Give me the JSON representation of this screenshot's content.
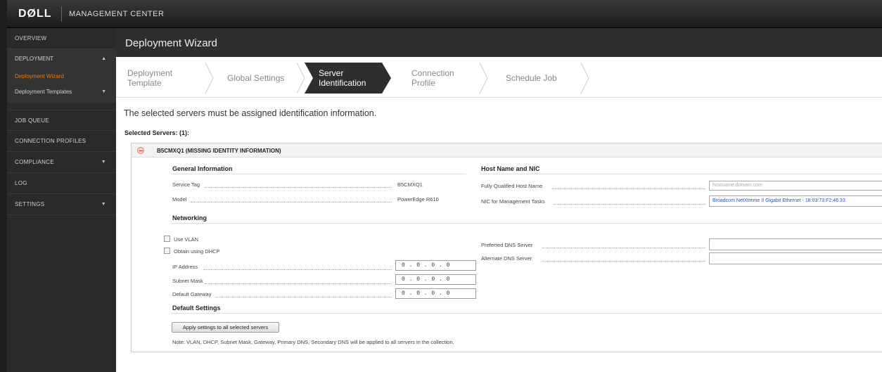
{
  "app": {
    "logo": "DØLL",
    "title": "MANAGEMENT CENTER"
  },
  "sidebar": {
    "overview": "OVERVIEW",
    "deployment": "DEPLOYMENT",
    "deployment_wizard": "Deployment Wizard",
    "deployment_templates": "Deployment Templates",
    "job_queue": "JOB QUEUE",
    "connection_profiles": "CONNECTION PROFILES",
    "compliance": "COMPLIANCE",
    "log": "LOG",
    "settings": "SETTINGS",
    "active_color": "#e07b1c"
  },
  "main": {
    "title": "Deployment Wizard"
  },
  "wizard": {
    "steps": [
      {
        "line1": "Deployment",
        "line2": "Template"
      },
      {
        "line1": "Global Settings",
        "line2": ""
      },
      {
        "line1": "Server",
        "line2": "Identification"
      },
      {
        "line1": "Connection",
        "line2": "Profile"
      },
      {
        "line1": "Schedule Job",
        "line2": ""
      }
    ],
    "active_index": 2
  },
  "instruction": "The selected servers must be assigned identification information.",
  "selected_servers": "Selected Servers: (1):",
  "server": {
    "title": "B5CMXQ1 (MISSING IDENTITY INFORMATION)",
    "general": {
      "heading": "General Information",
      "service_tag_label": "Service Tag",
      "service_tag": "B5CMXQ1",
      "model_label": "Model",
      "model": "PowerEdge R610"
    },
    "hostnic": {
      "heading": "Host Name and NIC",
      "fqhn_label": "Fully Qualified Host Name",
      "fqhn_placeholder": "hostname.domain.com",
      "nic_label": "NIC for Management Tasks",
      "nic_value": "Broadcom NetXtreme II Gigabit Ethernet - 18:03:73:F2:46:33"
    },
    "networking": {
      "heading": "Networking",
      "use_vlan": "Use VLAN",
      "dhcp": "Obtain using DHCP",
      "ip_label": "IP Address",
      "ip_value": "0 . 0 . 0 . 0",
      "subnet_label": "Subnet Mask",
      "subnet_value": "0 . 0 . 0 . 0",
      "gateway_label": "Default Gateway",
      "gateway_value": "0 . 0 . 0 . 0",
      "pref_dns_label": "Preferred DNS Server",
      "alt_dns_label": "Alternate DNS Server"
    },
    "defaults": {
      "heading": "Default Settings",
      "apply_button": "Apply settings to all selected servers",
      "note": "Note: VLAN, DHCP, Subnet Mask, Gateway, Primary DNS, Secondary DNS will be applied to all servers in the collection."
    }
  }
}
